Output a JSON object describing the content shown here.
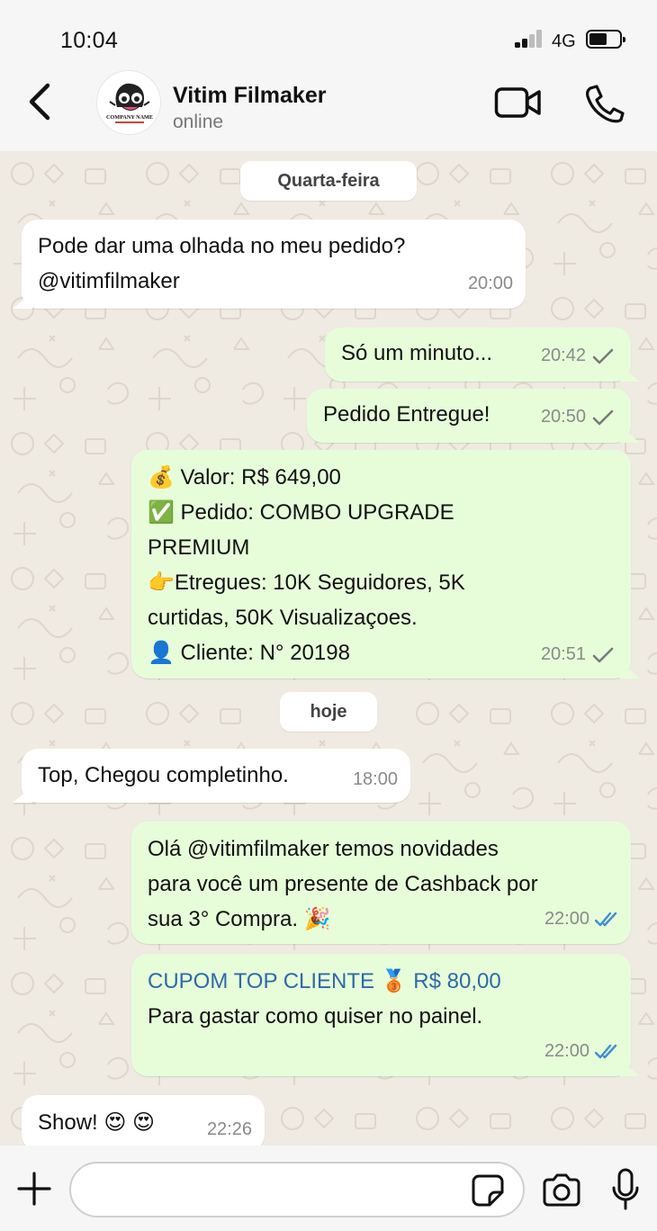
{
  "status_bar": {
    "time": "10:04",
    "network": "4G"
  },
  "header": {
    "contact_name": "Vitim Filmaker",
    "contact_status": "online",
    "avatar_text": "COMPANY NAME"
  },
  "chat": {
    "date_chips": [
      "Quarta-feira",
      "hoje"
    ],
    "messages": [
      {
        "dir": "in",
        "lines": [
          "Pode dar uma olhada no meu pedido?",
          "@vitimfilmaker"
        ],
        "time": "20:00"
      },
      {
        "dir": "out",
        "lines": [
          "Só um minuto..."
        ],
        "time": "20:42",
        "status": "sent"
      },
      {
        "dir": "out",
        "lines": [
          "Pedido Entregue!"
        ],
        "time": "20:50",
        "status": "sent"
      },
      {
        "dir": "out",
        "lines": [
          "💰 Valor: R$ 649,00",
          "✅ Pedido: COMBO UPGRADE",
          "PREMIUM",
          "👉Etregues: 10K Seguidores, 5K",
          "curtidas, 50K Visualizaçoes.",
          "👤 Cliente: N° 20198"
        ],
        "time": "20:51",
        "status": "sent"
      },
      {
        "dir": "in",
        "lines": [
          "Top, Chegou completinho."
        ],
        "time": "18:00"
      },
      {
        "dir": "out",
        "lines": [
          "Olá @vitimfilmaker temos novidades",
          "para você um presente de Cashback por",
          "sua 3° Compra. 🎉"
        ],
        "time": "22:00",
        "status": "read"
      },
      {
        "dir": "out",
        "lines": [
          "CUPOM TOP CLIENTE 🥉 R$ 80,00",
          "Para gastar como quiser no painel."
        ],
        "time": "22:00",
        "status": "read"
      },
      {
        "dir": "in",
        "lines": [
          "Show! 😍 😍"
        ],
        "time": "22:26"
      }
    ]
  },
  "composer": {
    "placeholder": ""
  },
  "colors": {
    "outgoing": "#e7fdd9",
    "incoming": "#ffffff",
    "read_tick": "#3b8fd6",
    "sent_tick": "#7a7a7a",
    "link": "#2d6aa8"
  }
}
